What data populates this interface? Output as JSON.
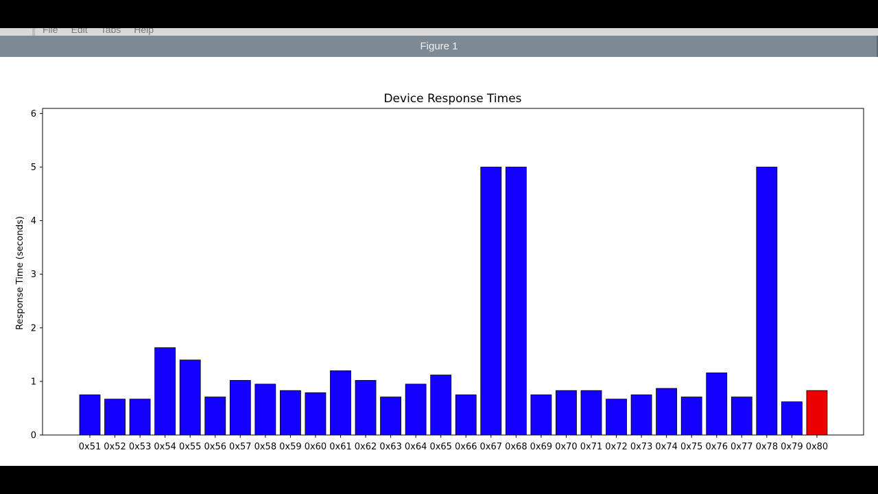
{
  "window": {
    "title": "Figure 1",
    "menu": [
      "File",
      "Edit",
      "Tabs",
      "Help"
    ]
  },
  "colors": {
    "default_bar": "#1400ff",
    "highlight_bar": "#ee0000"
  },
  "chart_data": {
    "type": "bar",
    "title": "Device Response Times",
    "xlabel": "",
    "ylabel": "Response Time (seconds)",
    "ylim": [
      0,
      6.1
    ],
    "yticks": [
      0,
      1,
      2,
      3,
      4,
      5,
      6
    ],
    "grid": false,
    "categories": [
      "0x51",
      "0x52",
      "0x53",
      "0x54",
      "0x55",
      "0x56",
      "0x57",
      "0x58",
      "0x59",
      "0x60",
      "0x61",
      "0x62",
      "0x63",
      "0x64",
      "0x65",
      "0x66",
      "0x67",
      "0x68",
      "0x69",
      "0x70",
      "0x71",
      "0x72",
      "0x73",
      "0x74",
      "0x75",
      "0x76",
      "0x77",
      "0x78",
      "0x79",
      "0x80"
    ],
    "values": [
      0.75,
      0.67,
      0.67,
      1.63,
      1.4,
      0.71,
      1.02,
      0.95,
      0.83,
      0.79,
      1.2,
      1.02,
      0.71,
      0.95,
      1.12,
      0.75,
      5.0,
      5.0,
      0.75,
      0.83,
      0.83,
      0.67,
      0.75,
      0.87,
      0.71,
      1.16,
      0.71,
      5.0,
      0.62,
      0.83
    ],
    "bar_colors": [
      "blue",
      "blue",
      "blue",
      "blue",
      "blue",
      "blue",
      "blue",
      "blue",
      "blue",
      "blue",
      "blue",
      "blue",
      "blue",
      "blue",
      "blue",
      "blue",
      "blue",
      "blue",
      "blue",
      "blue",
      "blue",
      "blue",
      "blue",
      "blue",
      "blue",
      "blue",
      "blue",
      "blue",
      "blue",
      "red"
    ]
  }
}
